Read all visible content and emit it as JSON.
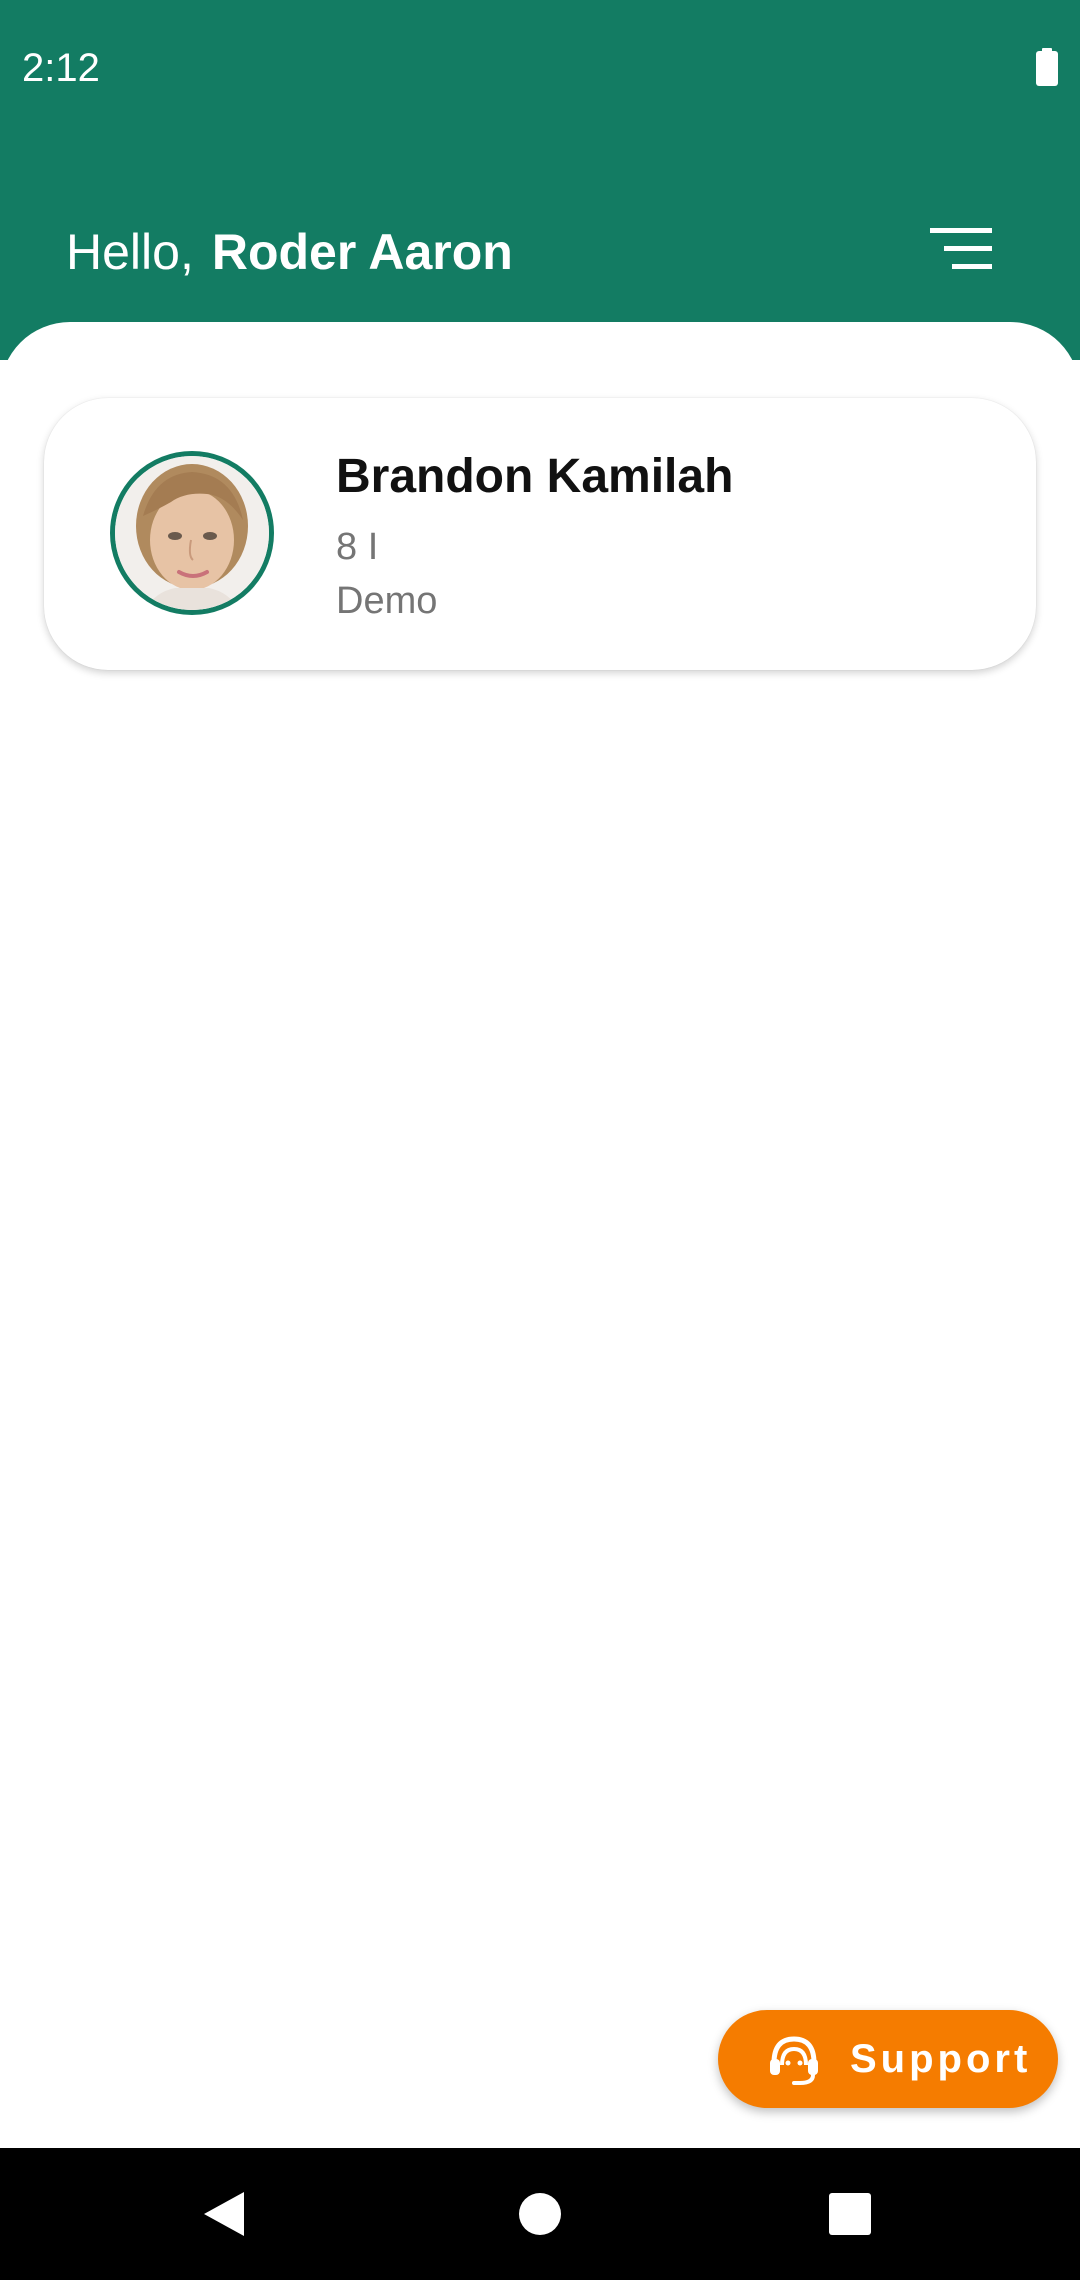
{
  "status_bar": {
    "time": "2:12",
    "battery_icon": "battery-full-icon"
  },
  "header": {
    "greeting": "Hello,",
    "user_name": "Roder Aaron",
    "menu_icon": "menu-icon"
  },
  "students": [
    {
      "name": "Brandon Kamilah",
      "class": "8 I",
      "school": "Demo"
    }
  ],
  "support": {
    "label": "Support",
    "icon": "headset-icon"
  },
  "nav": {
    "back_icon": "back-triangle-icon",
    "home_icon": "home-circle-icon",
    "recents_icon": "recents-square-icon"
  },
  "colors": {
    "primary": "#137c63",
    "support": "#f57c00",
    "text_secondary": "#757575"
  }
}
